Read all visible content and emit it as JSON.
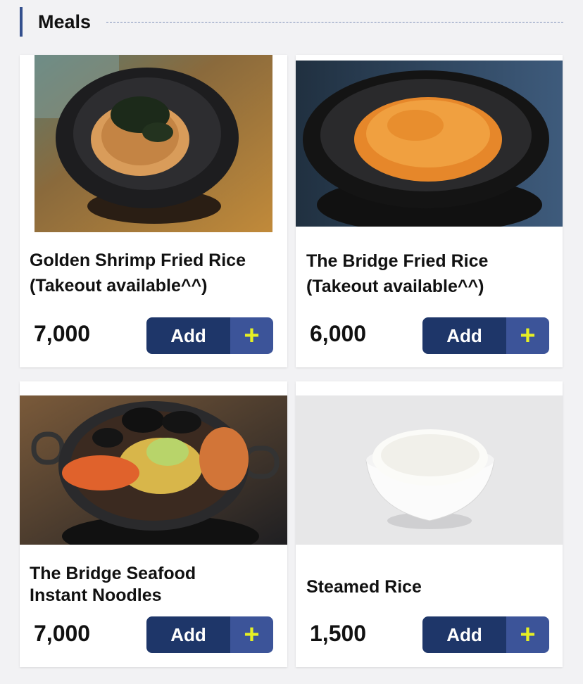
{
  "section": {
    "title": "Meals"
  },
  "items": [
    {
      "name": "Golden Shrimp Fried Rice\n(Takeout available^^)",
      "price": "7,000",
      "add_label": "Add",
      "plus_icon": "plus-icon",
      "image": "shrimp-fried-rice-photo"
    },
    {
      "name": "The Bridge Fried Rice\n(Takeout available^^)",
      "price": "6,000",
      "add_label": "Add",
      "plus_icon": "plus-icon",
      "image": "fried-rice-photo"
    },
    {
      "name": "The Bridge Seafood\nInstant Noodles",
      "price": "7,000",
      "add_label": "Add",
      "plus_icon": "plus-icon",
      "image": "seafood-noodles-photo"
    },
    {
      "name": "Steamed Rice",
      "price": "1,500",
      "add_label": "Add",
      "plus_icon": "plus-icon",
      "image": "steamed-rice-photo"
    }
  ],
  "colors": {
    "accent": "#1e3669",
    "accent_light": "#3c5499",
    "plus": "#e6f024",
    "header_bar": "#34508e"
  }
}
